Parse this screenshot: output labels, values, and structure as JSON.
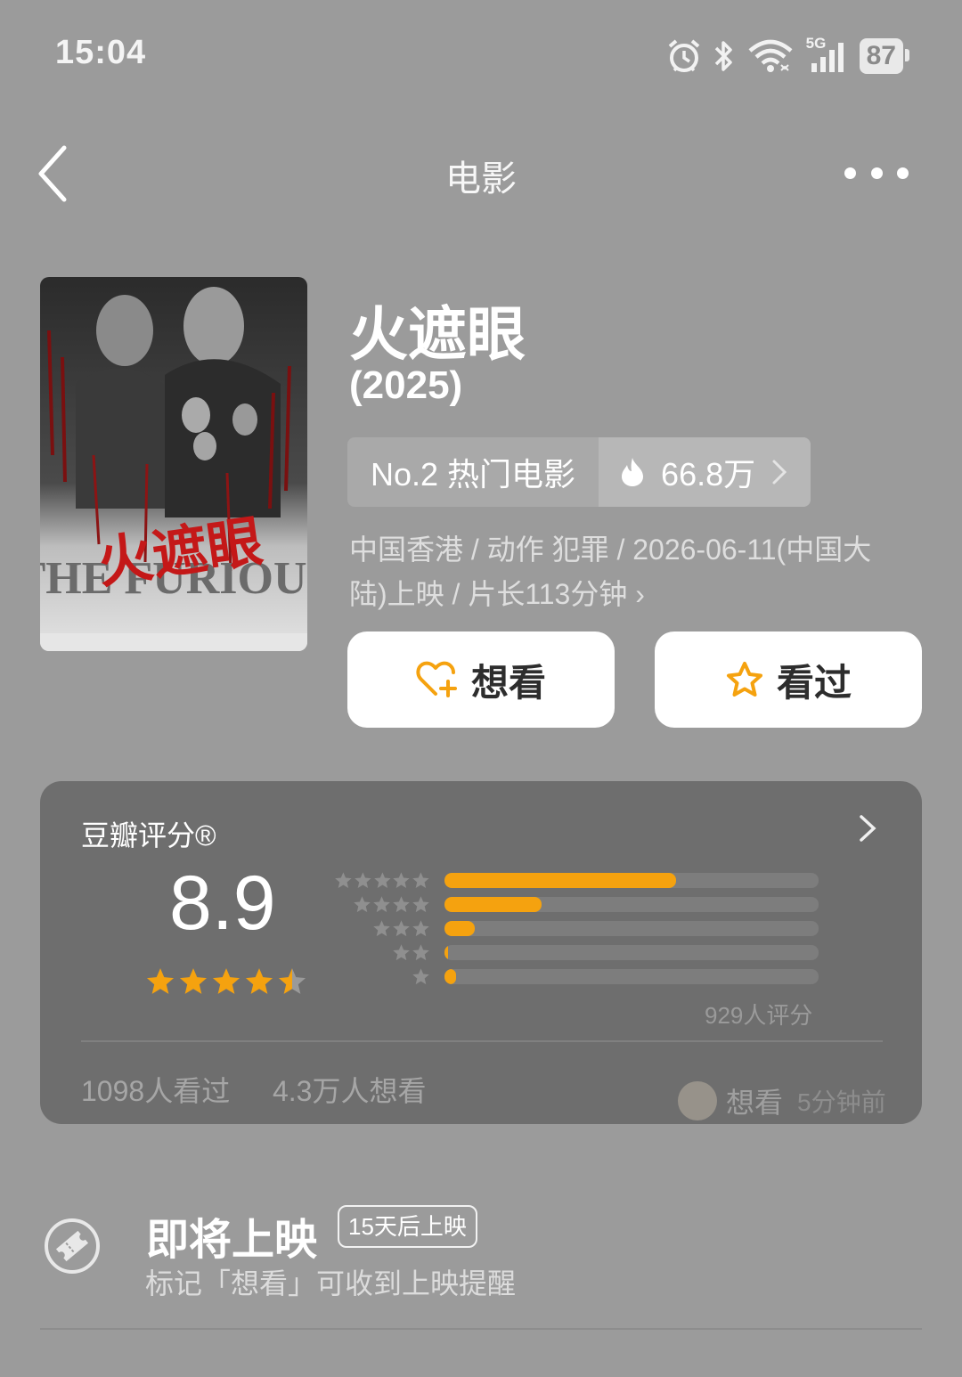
{
  "status_bar": {
    "time": "15:04",
    "network": "5G",
    "battery": "87",
    "icons": [
      "alarm-icon",
      "bluetooth-icon",
      "wifi-icon",
      "signal-icon",
      "battery-icon"
    ]
  },
  "nav": {
    "title": "电影",
    "back_icon": "chevron-left-icon",
    "more_icon": "more-dots-icon"
  },
  "movie": {
    "title": "火遮眼",
    "year": "(2025)",
    "rank_label": "No.2 热门电影",
    "heat_value": "66.8万",
    "meta_line1": "中国香港 / 动作 犯罪 / 2026-06-11(中国大",
    "meta_line2": "陆)上映 / 片长113分钟 ›",
    "poster_english": "THE FURIOUS"
  },
  "actions": {
    "want_label": "想看",
    "seen_label": "看过"
  },
  "rating": {
    "title": "豆瓣评分®",
    "score": "8.9",
    "stars_value": 4.5,
    "distribution": [
      {
        "stars": 5,
        "fraction": 0.62
      },
      {
        "stars": 4,
        "fraction": 0.26
      },
      {
        "stars": 3,
        "fraction": 0.08
      },
      {
        "stars": 2,
        "fraction": 0.01
      },
      {
        "stars": 1,
        "fraction": 0.03
      }
    ],
    "count_text": "929人评分",
    "seen_text": "1098人看过",
    "want_text": "4.3万人想看",
    "activity_action": "想看",
    "activity_time": "5分钟前"
  },
  "upcoming": {
    "title": "即将上映",
    "badge": "15天后上映",
    "subtitle": "标记「想看」可收到上映提醒"
  },
  "colors": {
    "accent_orange": "#f5a20f",
    "background": "#9b9b9b",
    "card": "#6e6e6e"
  }
}
